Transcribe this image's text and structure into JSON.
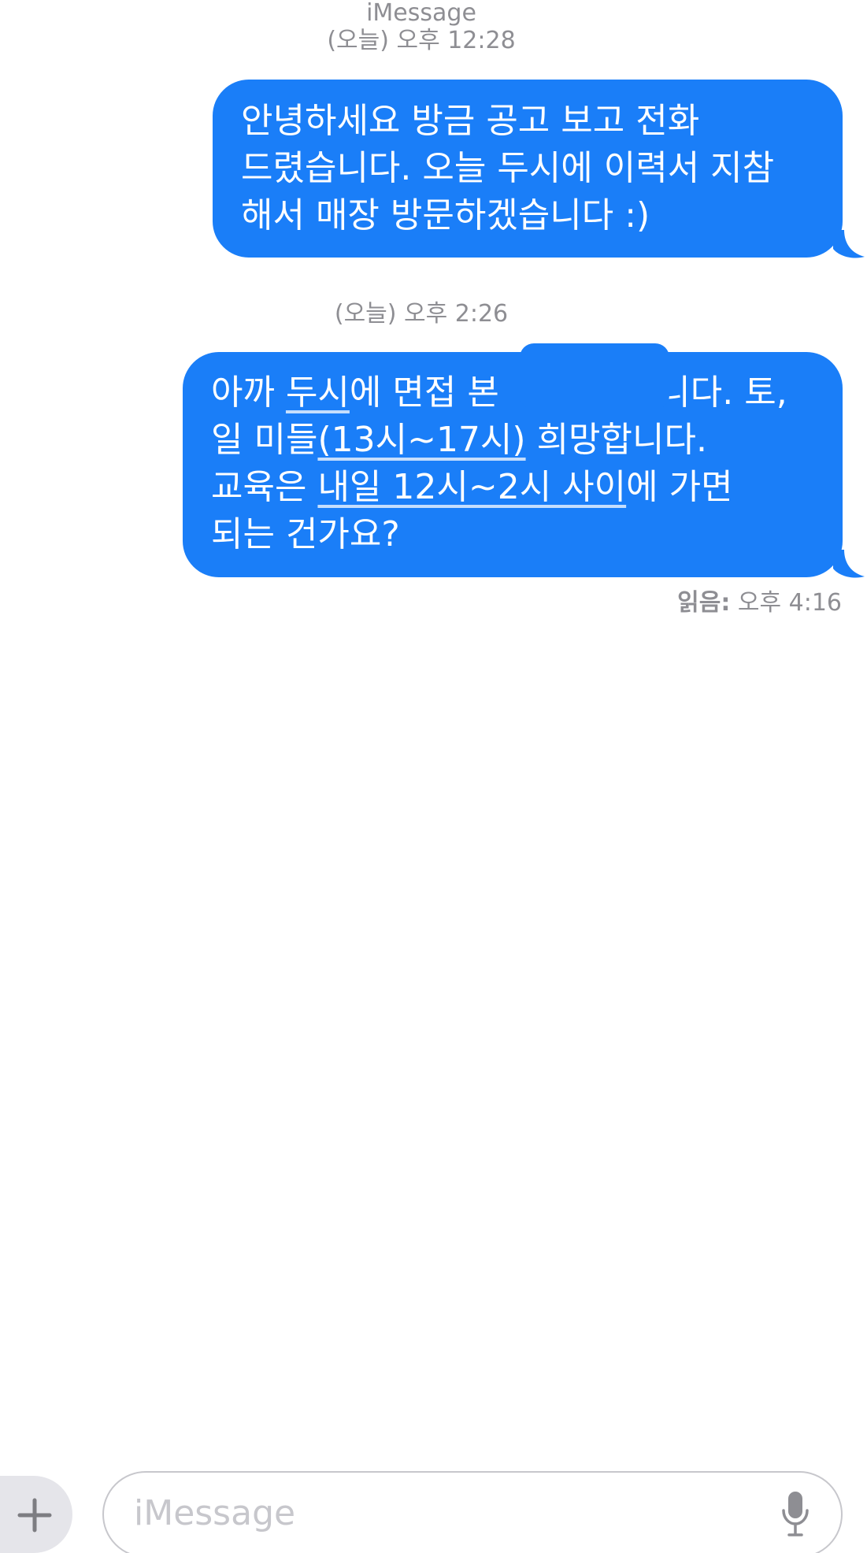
{
  "header": {
    "service": "iMessage",
    "first_timestamp": "(오늘) 오후 12:28"
  },
  "messages": [
    {
      "lines": [
        "안녕하세요 방금 공고 보고 전화",
        "드렸습니다. 오늘 두시에 이력서 지참",
        "해서 매장 방문하겠습니다 :)"
      ]
    },
    {
      "timestamp": "(오늘) 오후 2:26",
      "line1": {
        "a": "아까 ",
        "b": "두시",
        "c": "에 면접 본 ",
        "d": "입니다. 토,"
      },
      "line2": {
        "a": "일 미들",
        "b": "(13시~17시)",
        "c": " 희망합니다."
      },
      "line3": {
        "a": "교육은 ",
        "b": "내일 12시~2시 사이",
        "c": "에 가면"
      },
      "line4": "되는 건가요?"
    }
  ],
  "read_receipt": {
    "label": "읽음:",
    "time": "오후 4:16"
  },
  "compose": {
    "placeholder": "iMessage",
    "plus_icon": "plus-icon",
    "mic_icon": "microphone-icon"
  },
  "colors": {
    "bubble": "#1a7ef8",
    "meta_text": "#8e8e93"
  }
}
